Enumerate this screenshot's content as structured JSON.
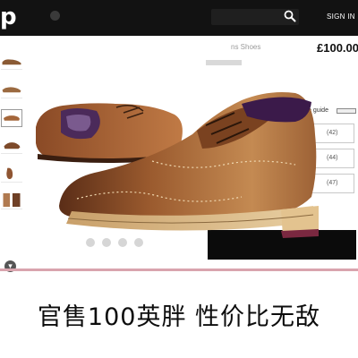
{
  "header": {
    "logo": "p",
    "sign_in": "SIGN IN"
  },
  "product": {
    "title_partial": "ns Shoes",
    "price": "£100.00",
    "size_guide_label": "e guide",
    "sizes": [
      "(42)",
      "(44)",
      "(47)"
    ]
  },
  "caption": "官售100英胖 性价比无敌",
  "colors": {
    "header_bg": "#121212",
    "divider": "#d9a4ae",
    "shoe_leather": "#a9683c"
  },
  "icons": {
    "search": "search-icon",
    "thumb_down_arrow": "chevron-down-icon"
  }
}
